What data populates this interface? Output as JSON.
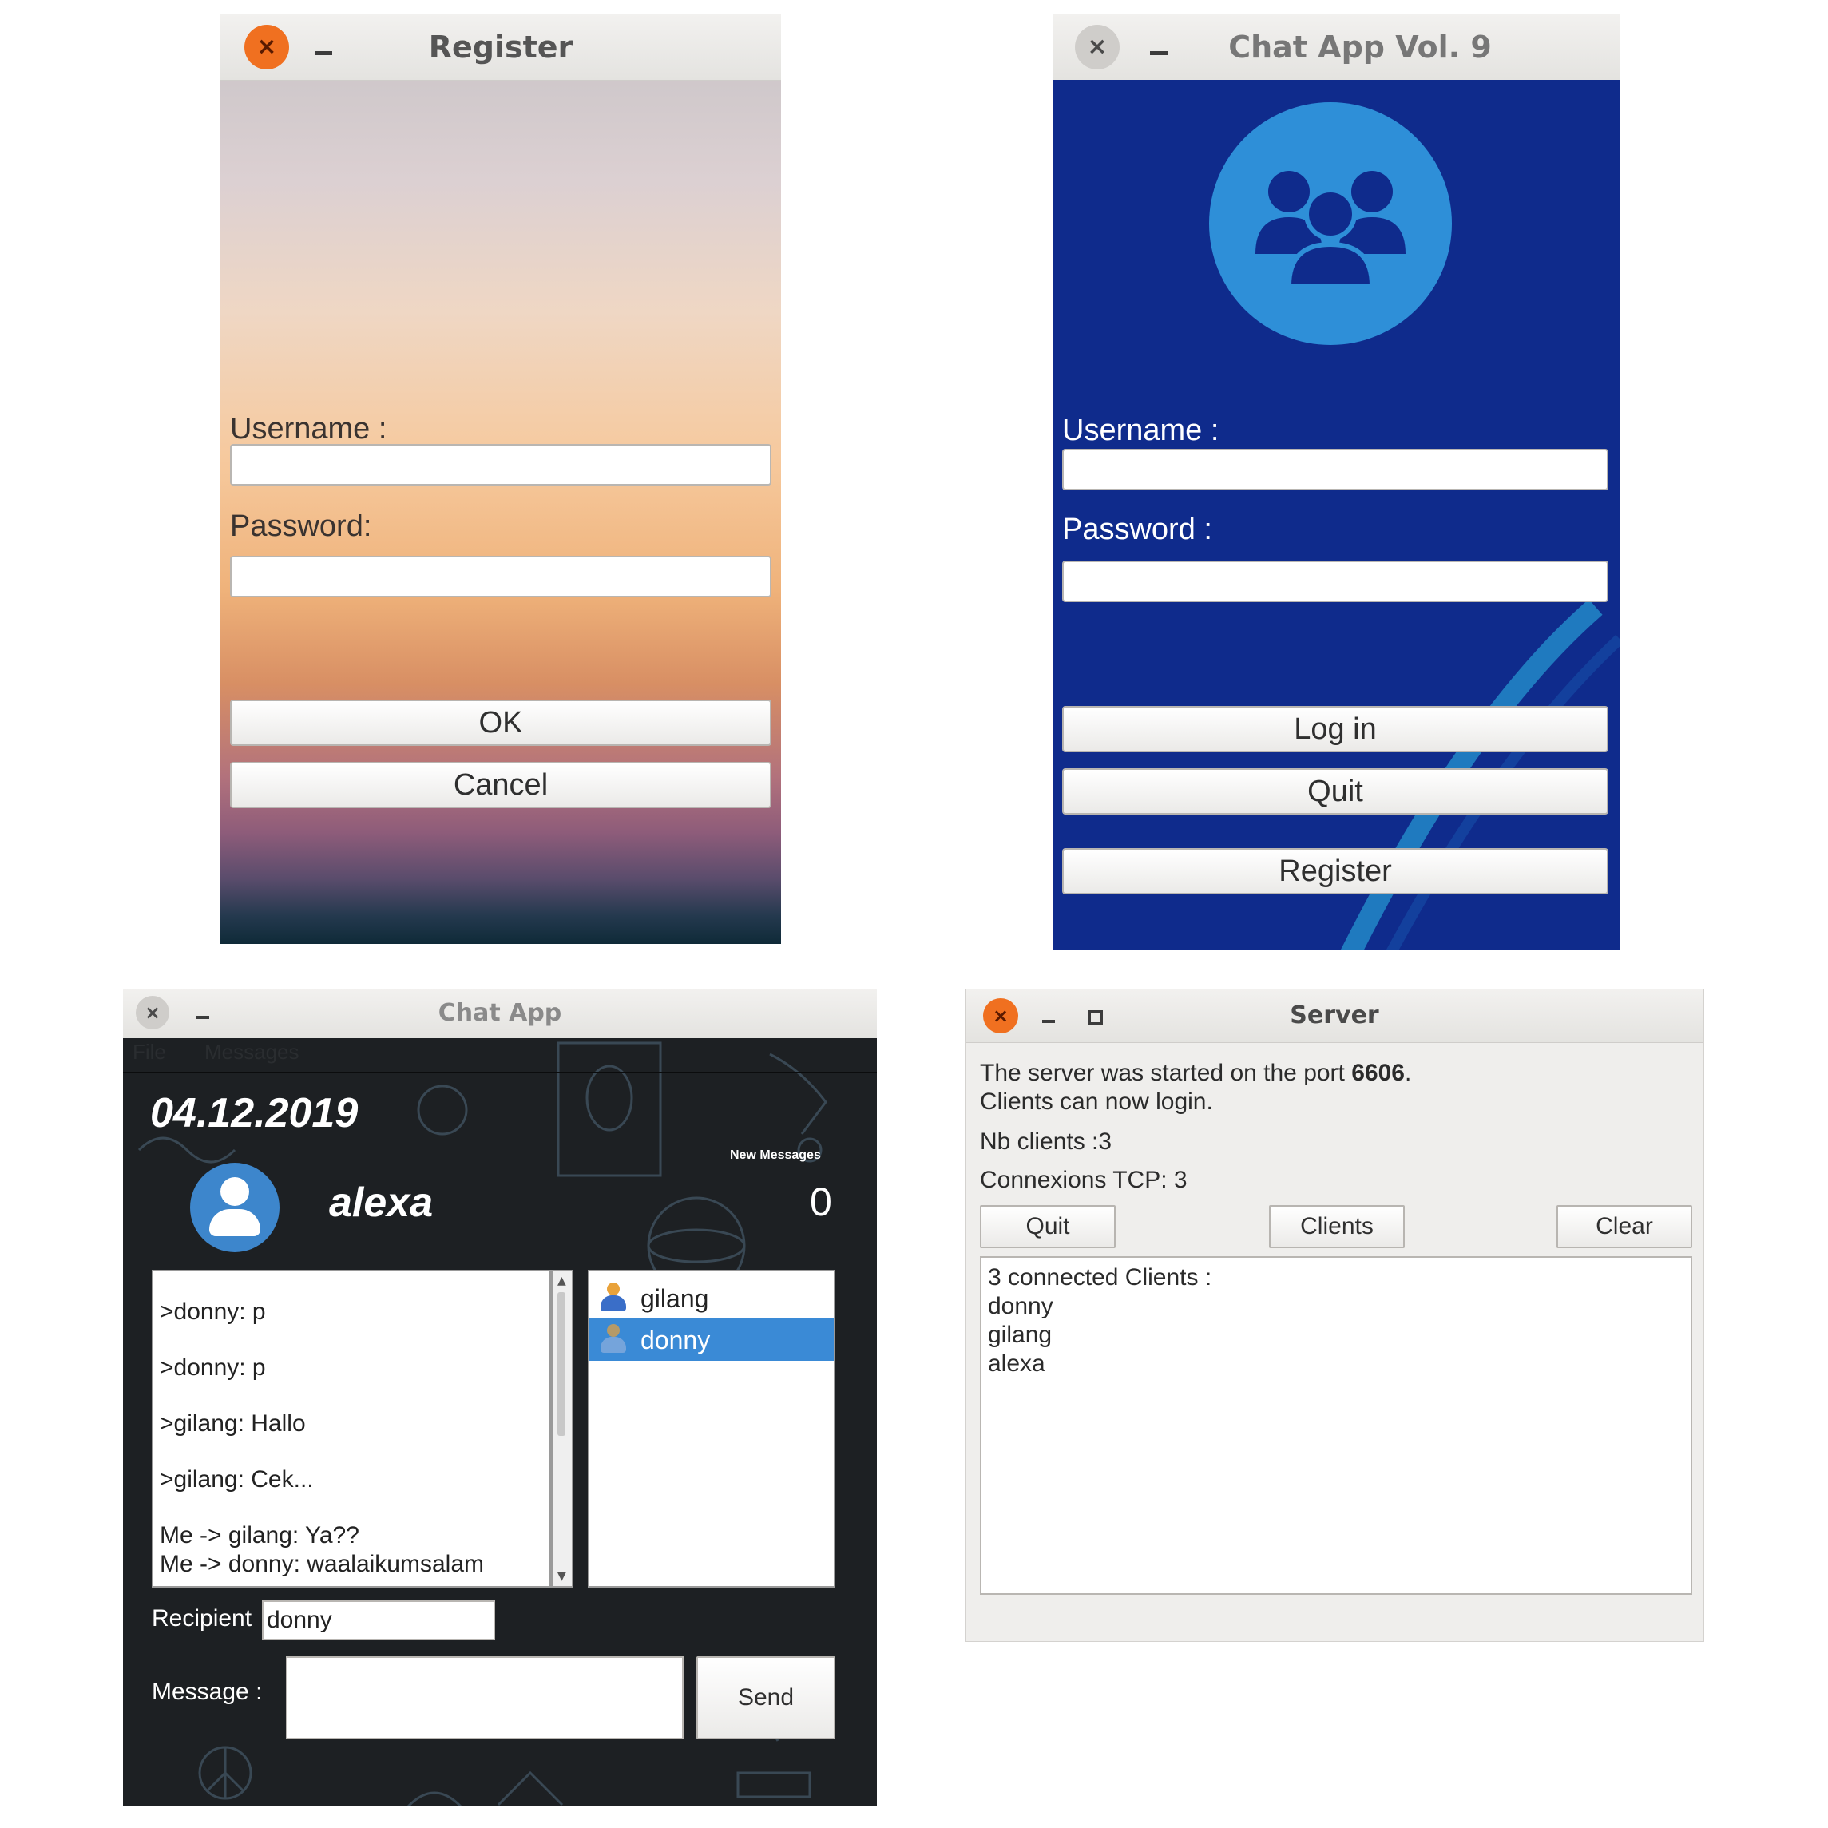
{
  "register": {
    "title": "Register",
    "username_label": "Username :",
    "password_label": "Password:",
    "username_value": "",
    "password_value": "",
    "ok_label": "OK",
    "cancel_label": "Cancel",
    "close_symbol": "×"
  },
  "login": {
    "title": "Chat App Vol. 9",
    "logo_icon": "group-users-icon",
    "username_label": "Username :",
    "password_label": "Password :",
    "username_value": "",
    "password_value": "",
    "login_label": "Log in",
    "quit_label": "Quit",
    "register_label": "Register",
    "close_symbol": "×",
    "accent_color": "#0f2b8c",
    "logo_color": "#2e8fd8"
  },
  "chat": {
    "title": "Chat App",
    "menu": [
      "File",
      "Messages"
    ],
    "date": "04.12.2019",
    "username": "alexa",
    "avatar_icon": "user-avatar-icon",
    "new_messages_label": "New Messages",
    "new_messages_count": "0",
    "messages": [
      ">donny: p",
      ">donny: p",
      ">gilang: Hallo",
      ">gilang: Cek...",
      "Me -> gilang:  Ya??",
      "Me -> donny:  waalaikumsalam"
    ],
    "users": [
      {
        "name": "gilang",
        "selected": false
      },
      {
        "name": "donny",
        "selected": true
      }
    ],
    "recipient_label": "Recipient",
    "recipient_value": "donny",
    "message_label": "Message  :",
    "message_value": "",
    "send_label": "Send",
    "close_symbol": "×",
    "selection_color": "#3a8ad6"
  },
  "server": {
    "title": "Server",
    "status_prefix": "The server was started on the port ",
    "port": "6606",
    "status_suffix": ".",
    "status_line2": "Clients can now login.",
    "nb_clients": "Nb clients :3",
    "tcp": "Connexions TCP: 3",
    "quit_label": "Quit",
    "clients_label": "Clients",
    "clear_label": "Clear",
    "log_lines": [
      "3 connected Clients :",
      "donny",
      "gilang",
      "alexa"
    ],
    "close_symbol": "×"
  }
}
